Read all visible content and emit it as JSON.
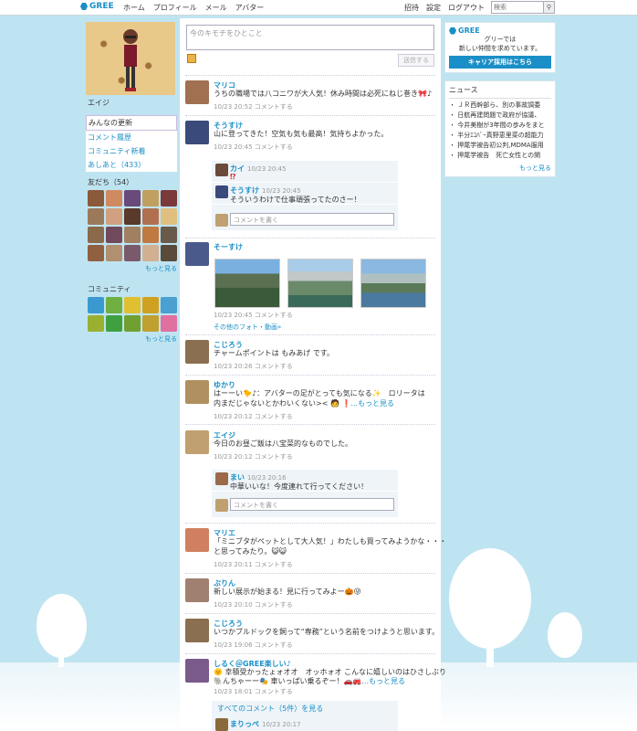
{
  "topbar": {
    "logo": "GREE",
    "nav_left": [
      "ホーム",
      "プロフィール",
      "メール",
      "アバター"
    ],
    "nav_right": [
      "招待",
      "設定",
      "ログアウト"
    ],
    "search_placeholder": "検索"
  },
  "left": {
    "user_name": "エイジ",
    "menu": [
      "みんなの更新",
      "コメント履歴",
      "コミュニティ新着",
      "あしあと（433）"
    ],
    "friends_title": "友だち（54）",
    "community_title": "コミュニティ",
    "more": "もっと見る",
    "friend_colors": [
      "#8a5a3a",
      "#d08a60",
      "#6a4a7a",
      "#c0a060",
      "#7a3a3a",
      "#9a7a5a",
      "#d0a080",
      "#5a3a2a",
      "#b07050",
      "#e0c080",
      "#8a6a4a",
      "#704a5a",
      "#a08060",
      "#c07a40",
      "#6a5a4a",
      "#906040",
      "#b09070",
      "#7a5a6a",
      "#d0b090",
      "#5a4a3a"
    ],
    "community_colors": [
      "#3a9ad0",
      "#70b040",
      "#e0c030",
      "#d0a020",
      "#4aa0d0",
      "#9ab030",
      "#40a040",
      "#70a030",
      "#c0a030",
      "#e070a0"
    ]
  },
  "right": {
    "ad_logo": "GREE",
    "ad_text": "グリーでは\n新しい仲間を求めています。",
    "ad_button": "キャリア採用はこちら",
    "news_title": "ニュース",
    "news": [
      "ＪＲ西幹部ら、別の事故調委",
      "日航再建問題で政府が協議、",
      "今井美樹が3年間の歩みをまと",
      "半分ｴｺﾊﾞｰ真野恵里菜の超能力",
      "押尾学被告初公判,MDMA服用",
      "押尾学被告　死亡女性との関"
    ],
    "more": "もっと見る"
  },
  "status": {
    "placeholder": "今のキモチをひとこと",
    "send": "送信する"
  },
  "feed": {
    "posts": [
      {
        "name": "マリコ",
        "text": "うちの職場では八コニワが大人気！休み時間は必死にねじ巻き🎀♪",
        "meta": "10/23 20:52 コメントする",
        "color": "#a07050"
      },
      {
        "name": "そうすけ",
        "text": "山に登ってきた！空気も気も最高！気持ちよかった。",
        "meta": "10/23 20:45 コメントする",
        "color": "#3a4a7a"
      },
      {
        "name": "そーすけ",
        "text": "",
        "meta": "10/23 20:45 コメントする",
        "color": "#4a5a8a",
        "photo_link": "その他のフォト・動画»"
      },
      {
        "name": "こじろう",
        "text": "チャームポイントは もみあげ です。",
        "meta": "10/23 20:26 コメントする",
        "color": "#8a7050"
      },
      {
        "name": "ゆかり",
        "text": "はーーい🐤♪：アバターの足がとっても気になる✨　ロリータは",
        "text2": "内まだじゃないとかわいくない>< 🧑 ❗",
        "more": "...もっと見る",
        "meta": "10/23 20:12 コメントする",
        "color": "#b09060"
      },
      {
        "name": "エイジ",
        "text": "今日のお昼ご飯は八宝菜的なものでした。",
        "meta": "10/23 20:12 コメントする",
        "color": "#c0a070"
      },
      {
        "name": "マリエ",
        "text": "「ミニブタがペットとして大人気！」わたしも買ってみようかな・・・",
        "text2": "と思ってみたり。😺😺",
        "meta": "10/23 20:11 コメントする",
        "color": "#d08060"
      },
      {
        "name": "ぶりん",
        "text": "新しい展示が始まる！見に行ってみよー🎃😜",
        "meta": "10/23 20:10 コメントする",
        "color": "#a08070"
      },
      {
        "name": "こじろう",
        "text": "いつかブルドックを飼って“専務”という名前をつけようと思います。",
        "meta": "10/23 19:06 コメントする",
        "color": "#8a7050"
      },
      {
        "name": "しるく＠GREE楽しい♪",
        "text": "🌞 幸積受かったょォオオ　オッホォオ こんなに嬉しいのはひさしぶり",
        "text2": "🐘んちゃーー🎭 車いっぱい乗るぞー！🚗🚒",
        "more": "...もっと見る",
        "meta": "10/23 18:01 コメントする",
        "color": "#7a5a8a"
      }
    ],
    "comments_sosuke": [
      {
        "name": "カイ",
        "time": "10/23 20:45",
        "text": "⁉",
        "color": "#6a4a3a"
      },
      {
        "name": "そうすけ",
        "time": "10/23 20:45",
        "text": "そういうわけで仕事頑張ってたのさー！",
        "color": "#3a4a7a"
      }
    ],
    "comments_eiji": [
      {
        "name": "まい",
        "time": "10/23 20:16",
        "text": "中華いいな！今度連れて行ってください！",
        "color": "#9a6a4a"
      }
    ],
    "comment_placeholder": "コメントを書く",
    "all_comments": "すべてのコメント（5件）を見る",
    "last_comment": {
      "name": "まりっぺ",
      "time": "10/23 20:17",
      "color": "#8a6a3a"
    }
  }
}
